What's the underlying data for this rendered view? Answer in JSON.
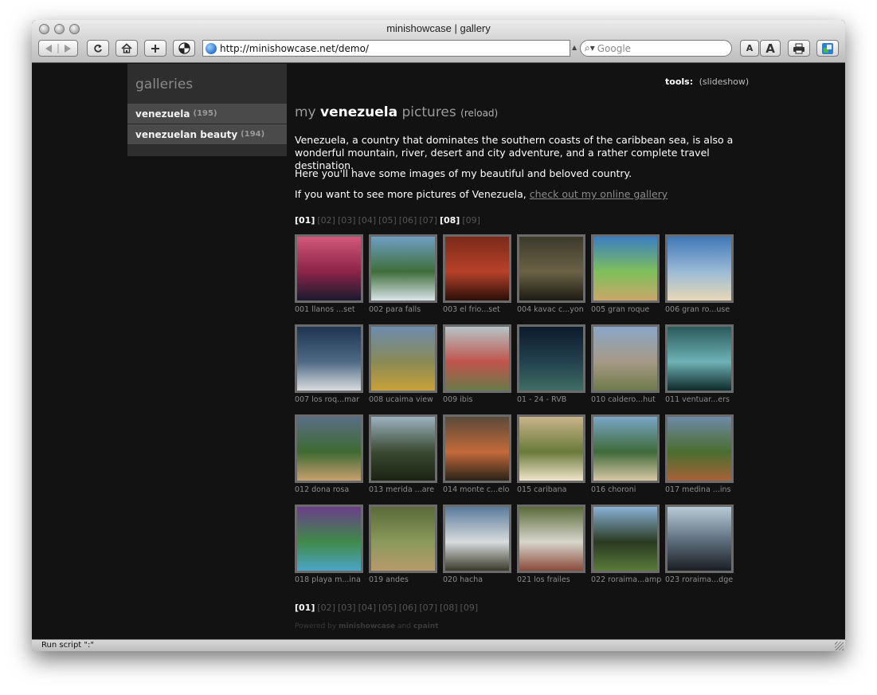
{
  "window": {
    "title": "minishowcase | gallery",
    "url": "http://minishowcase.net/demo/",
    "search_placeholder": "Google",
    "font_small_label": "A",
    "font_large_label": "A",
    "status_text": "Run script \":\""
  },
  "sidebar": {
    "heading": "galleries",
    "items": [
      {
        "label": "venezuela",
        "count": "(195)"
      },
      {
        "label": "venezuelan beauty",
        "count": "(194)"
      }
    ]
  },
  "tools": {
    "label": "tools:",
    "slideshow": "(slideshow)"
  },
  "page": {
    "title_prefix": "my",
    "title_name": "venezuela",
    "title_suffix": "pictures",
    "reload": "(reload)",
    "intro": "Venezuela, a country that dominates the southern coasts of the caribbean sea, is also a wonderful mountain, river, desert and city adventure, and a rather complete travel destination.",
    "line2": "Here you'll have some images of my beautiful and beloved country.",
    "line3_prefix": "If you want to see more pictures of Venezuela,",
    "line3_link": "check out my online gallery"
  },
  "pager": {
    "pages": [
      "[01]",
      "[02]",
      "[03]",
      "[04]",
      "[05]",
      "[06]",
      "[07]",
      "[08]",
      "[09]"
    ],
    "current_top": [
      "[01]",
      "[08]"
    ],
    "current_bottom": [
      "[01]"
    ]
  },
  "thumbnails": [
    {
      "caption": "001 llanos ...set",
      "colors": [
        "#d2587a",
        "#8c2448",
        "#1a1a2e"
      ]
    },
    {
      "caption": "002 para falls",
      "colors": [
        "#6f9fc4",
        "#3f6e3b",
        "#d9e4e8"
      ]
    },
    {
      "caption": "003 el frio...set",
      "colors": [
        "#7a2a1a",
        "#b8422a",
        "#2a0e08"
      ]
    },
    {
      "caption": "004 kavac c...yon",
      "colors": [
        "#3b3a2a",
        "#6b6246",
        "#1c1b14"
      ]
    },
    {
      "caption": "005 gran roque",
      "colors": [
        "#3a7ec4",
        "#7fbf5a",
        "#caa66a"
      ]
    },
    {
      "caption": "006 gran ro...use",
      "colors": [
        "#3f78b8",
        "#9cbad6",
        "#e7d8b6"
      ]
    },
    {
      "caption": "007 los roq...mar",
      "colors": [
        "#1e3550",
        "#4e6a86",
        "#d9dcde"
      ]
    },
    {
      "caption": "008 ucaima view",
      "colors": [
        "#6c8db0",
        "#8a8a55",
        "#c8a23a"
      ]
    },
    {
      "caption": "009 ibis",
      "colors": [
        "#b8c4c8",
        "#c0544c",
        "#6a7a4a"
      ]
    },
    {
      "caption": "01 - 24 - RVB",
      "colors": [
        "#0c1a2a",
        "#23414f",
        "#3f6d63"
      ]
    },
    {
      "caption": "010 caldero...hut",
      "colors": [
        "#8aa6c8",
        "#a69a86",
        "#6e7a4a"
      ]
    },
    {
      "caption": "011 ventuar...ers",
      "colors": [
        "#2a5a5a",
        "#6eb2b6",
        "#0f2a2a"
      ]
    },
    {
      "caption": "012 dona rosa",
      "colors": [
        "#5a6e86",
        "#3e6a32",
        "#c8a070"
      ]
    },
    {
      "caption": "013 merida ...are",
      "colors": [
        "#9cb2c0",
        "#3a4a32",
        "#1a2212"
      ]
    },
    {
      "caption": "014 monte c...elo",
      "colors": [
        "#5a4a3a",
        "#c46a3a",
        "#2a2218"
      ]
    },
    {
      "caption": "015 caribana",
      "colors": [
        "#c8b48a",
        "#6a7a3a",
        "#f0e6cc"
      ]
    },
    {
      "caption": "016 choroni",
      "colors": [
        "#7aa6c8",
        "#3f6a3a",
        "#d8c8a6"
      ]
    },
    {
      "caption": "017 medina ...ins",
      "colors": [
        "#6f8aa8",
        "#4a6e2e",
        "#a8623a"
      ]
    },
    {
      "caption": "018 playa m...ina",
      "colors": [
        "#6a3f8a",
        "#3f8a4a",
        "#4aa6c8"
      ]
    },
    {
      "caption": "019 andes",
      "colors": [
        "#5a6a3a",
        "#8a9a5a",
        "#b89a6a"
      ]
    },
    {
      "caption": "020 hacha",
      "colors": [
        "#5a7a9a",
        "#d8dcde",
        "#3a3a2a"
      ]
    },
    {
      "caption": "021 los frailes",
      "colors": [
        "#5a6a3a",
        "#d8d6cc",
        "#8a4a3a"
      ]
    },
    {
      "caption": "022 roraima...amp",
      "colors": [
        "#8ab2d6",
        "#2a3a22",
        "#5a7a3a"
      ]
    },
    {
      "caption": "023 roraima...dge",
      "colors": [
        "#b8cad6",
        "#5a6a7a",
        "#1a1e22"
      ]
    }
  ],
  "footer": {
    "powered_by": "Powered by",
    "minishowcase": "minishowcase",
    "and": "and",
    "cpaint": "cpaint"
  }
}
